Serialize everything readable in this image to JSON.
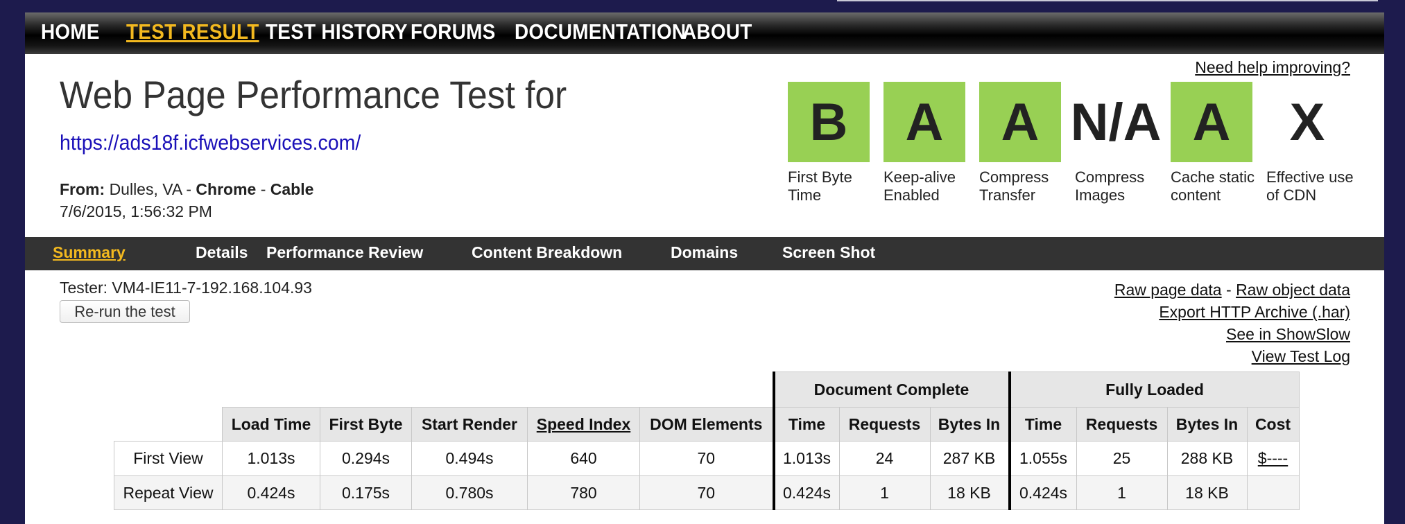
{
  "nav": {
    "items": [
      {
        "label": "HOME",
        "active": false
      },
      {
        "label": "TEST RESULT",
        "active": true
      },
      {
        "label": "TEST HISTORY",
        "active": false
      },
      {
        "label": "FORUMS",
        "active": false
      },
      {
        "label": "DOCUMENTATION",
        "active": false
      },
      {
        "label": "ABOUT",
        "active": false
      }
    ]
  },
  "header": {
    "title": "Web Page Performance Test for",
    "url": "https://ads18f.icfwebservices.com/",
    "from_label": "From:",
    "from_location": "Dulles, VA",
    "sep": "-",
    "browser": "Chrome",
    "connection": "Cable",
    "date": "7/6/2015, 1:56:32 PM",
    "help_link": "Need help improving?"
  },
  "grades": [
    {
      "grade": "B",
      "label": "First Byte Time",
      "color": "#98d054"
    },
    {
      "grade": "A",
      "label": "Keep-alive Enabled",
      "color": "#98d054"
    },
    {
      "grade": "A",
      "label": "Compress Transfer",
      "color": "#98d054"
    },
    {
      "grade": "N/A",
      "label": "Compress Images",
      "color": ""
    },
    {
      "grade": "A",
      "label": "Cache static content",
      "color": "#98d054"
    },
    {
      "grade": "X",
      "label": "Effective use of CDN",
      "color": ""
    }
  ],
  "subnav": {
    "items": [
      {
        "label": "Summary",
        "active": true
      },
      {
        "label": "Details",
        "active": false
      },
      {
        "label": "Performance Review",
        "active": false
      },
      {
        "label": "Content Breakdown",
        "active": false
      },
      {
        "label": "Domains",
        "active": false
      },
      {
        "label": "Screen Shot",
        "active": false
      }
    ]
  },
  "tester": "Tester: VM4-IE11-7-192.168.104.93",
  "rerun_label": "Re-run the test",
  "links": {
    "raw_page": "Raw page data",
    "sep": "-",
    "raw_object": "Raw object data",
    "export_har": "Export HTTP Archive (.har)",
    "showslow": "See in ShowSlow",
    "test_log": "View Test Log"
  },
  "table": {
    "group_document": "Document Complete",
    "group_fully": "Fully Loaded",
    "headers": [
      "Load Time",
      "First Byte",
      "Start Render",
      "Speed Index",
      "DOM Elements",
      "Time",
      "Requests",
      "Bytes In",
      "Time",
      "Requests",
      "Bytes In",
      "Cost"
    ],
    "rows": [
      {
        "label": "First View",
        "values": [
          "1.013s",
          "0.294s",
          "0.494s",
          "640",
          "70",
          "1.013s",
          "24",
          "287 KB",
          "1.055s",
          "25",
          "288 KB",
          "$----"
        ]
      },
      {
        "label": "Repeat View",
        "values": [
          "0.424s",
          "0.175s",
          "0.780s",
          "780",
          "70",
          "0.424s",
          "1",
          "18 KB",
          "0.424s",
          "1",
          "18 KB",
          ""
        ]
      }
    ]
  },
  "colors": {
    "nav_active": "#f3b91f",
    "grade_green": "#98d054",
    "link_blue": "#1a10b8",
    "page_background": "#1d1b4d"
  }
}
